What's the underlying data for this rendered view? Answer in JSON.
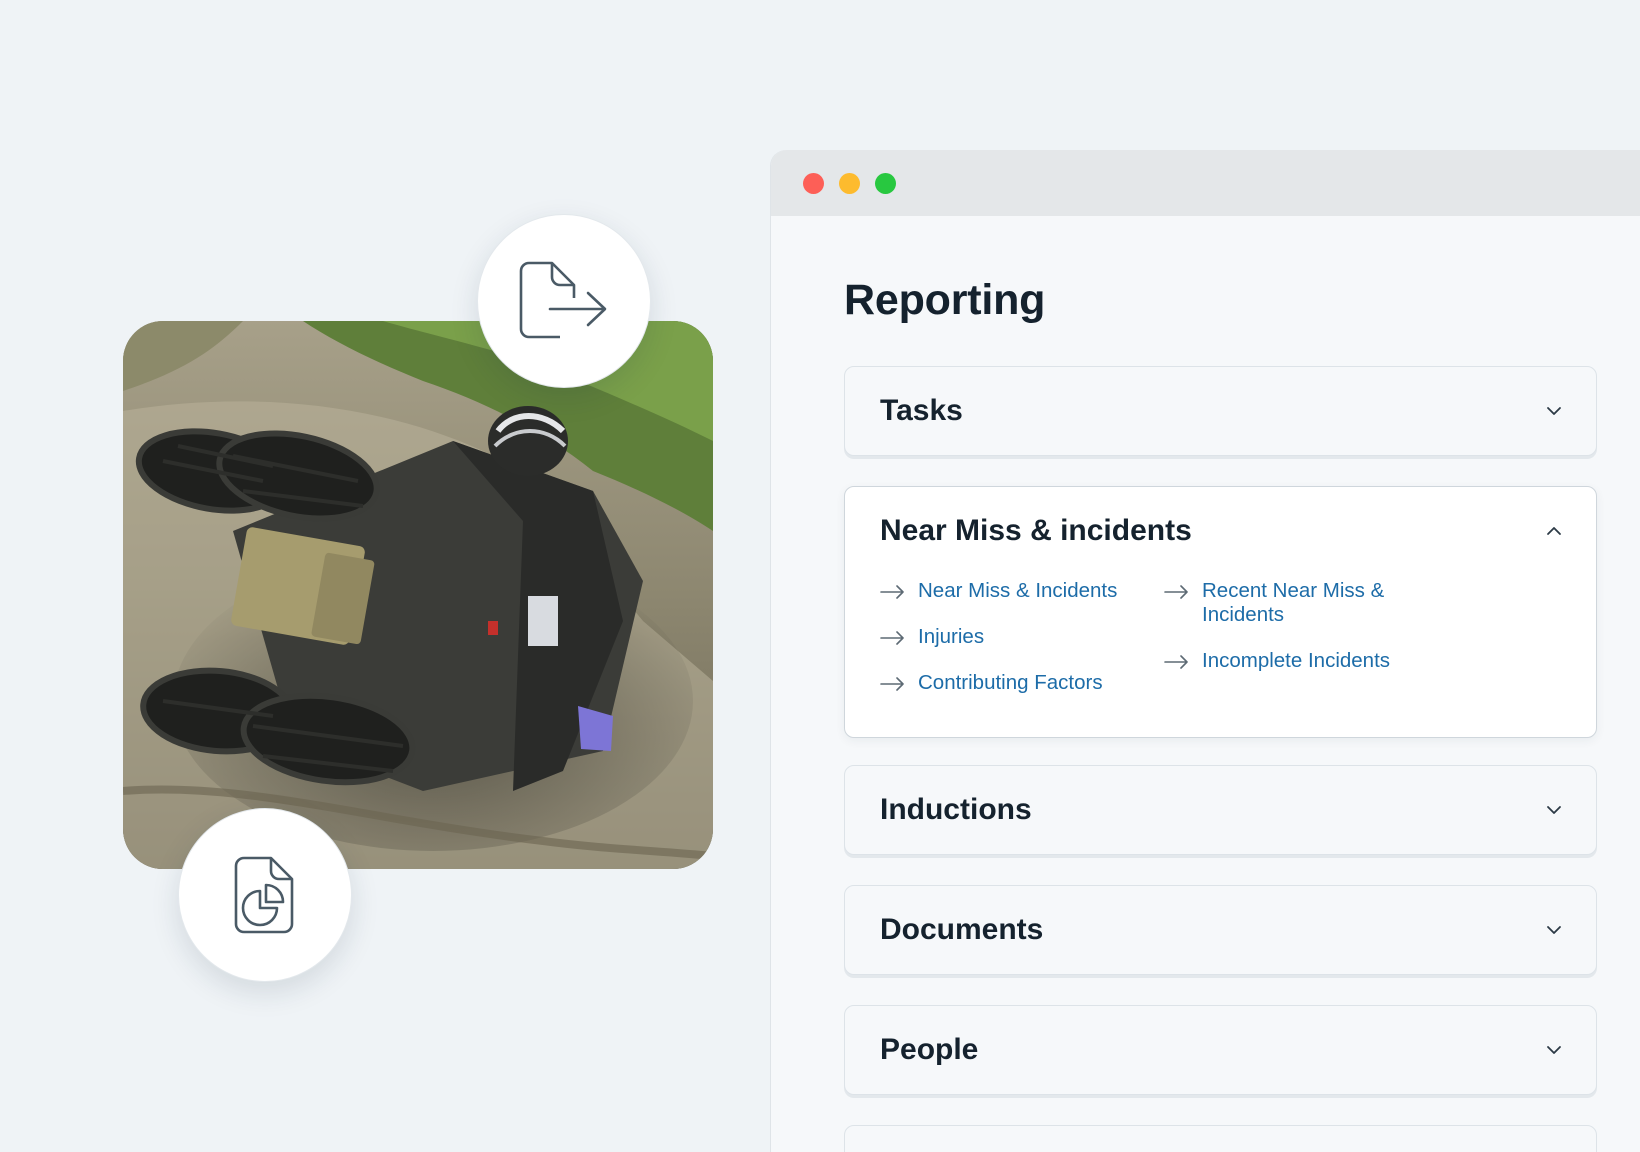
{
  "window": {
    "title": "Reporting"
  },
  "sections": [
    {
      "title": "Tasks",
      "expanded": false
    },
    {
      "title": "Near Miss & incidents",
      "expanded": true,
      "links_left": [
        "Near Miss & Incidents",
        "Injuries",
        "Contributing Factors"
      ],
      "links_right": [
        "Recent Near Miss & Incidents",
        "Incomplete Incidents"
      ]
    },
    {
      "title": "Inductions",
      "expanded": false
    },
    {
      "title": "Documents",
      "expanded": false
    },
    {
      "title": "People",
      "expanded": false
    }
  ],
  "icons": {
    "export": "document-export-icon",
    "report": "document-pie-chart-icon",
    "link_arrow": "arrow-right-icon",
    "collapse": "chevron-up-icon",
    "expand": "chevron-down-icon"
  },
  "colors": {
    "link": "#1d6ca8",
    "heading": "#15222e",
    "traffic_red": "#fd5f57",
    "traffic_yellow": "#fdbb2e",
    "traffic_green": "#28c840"
  }
}
